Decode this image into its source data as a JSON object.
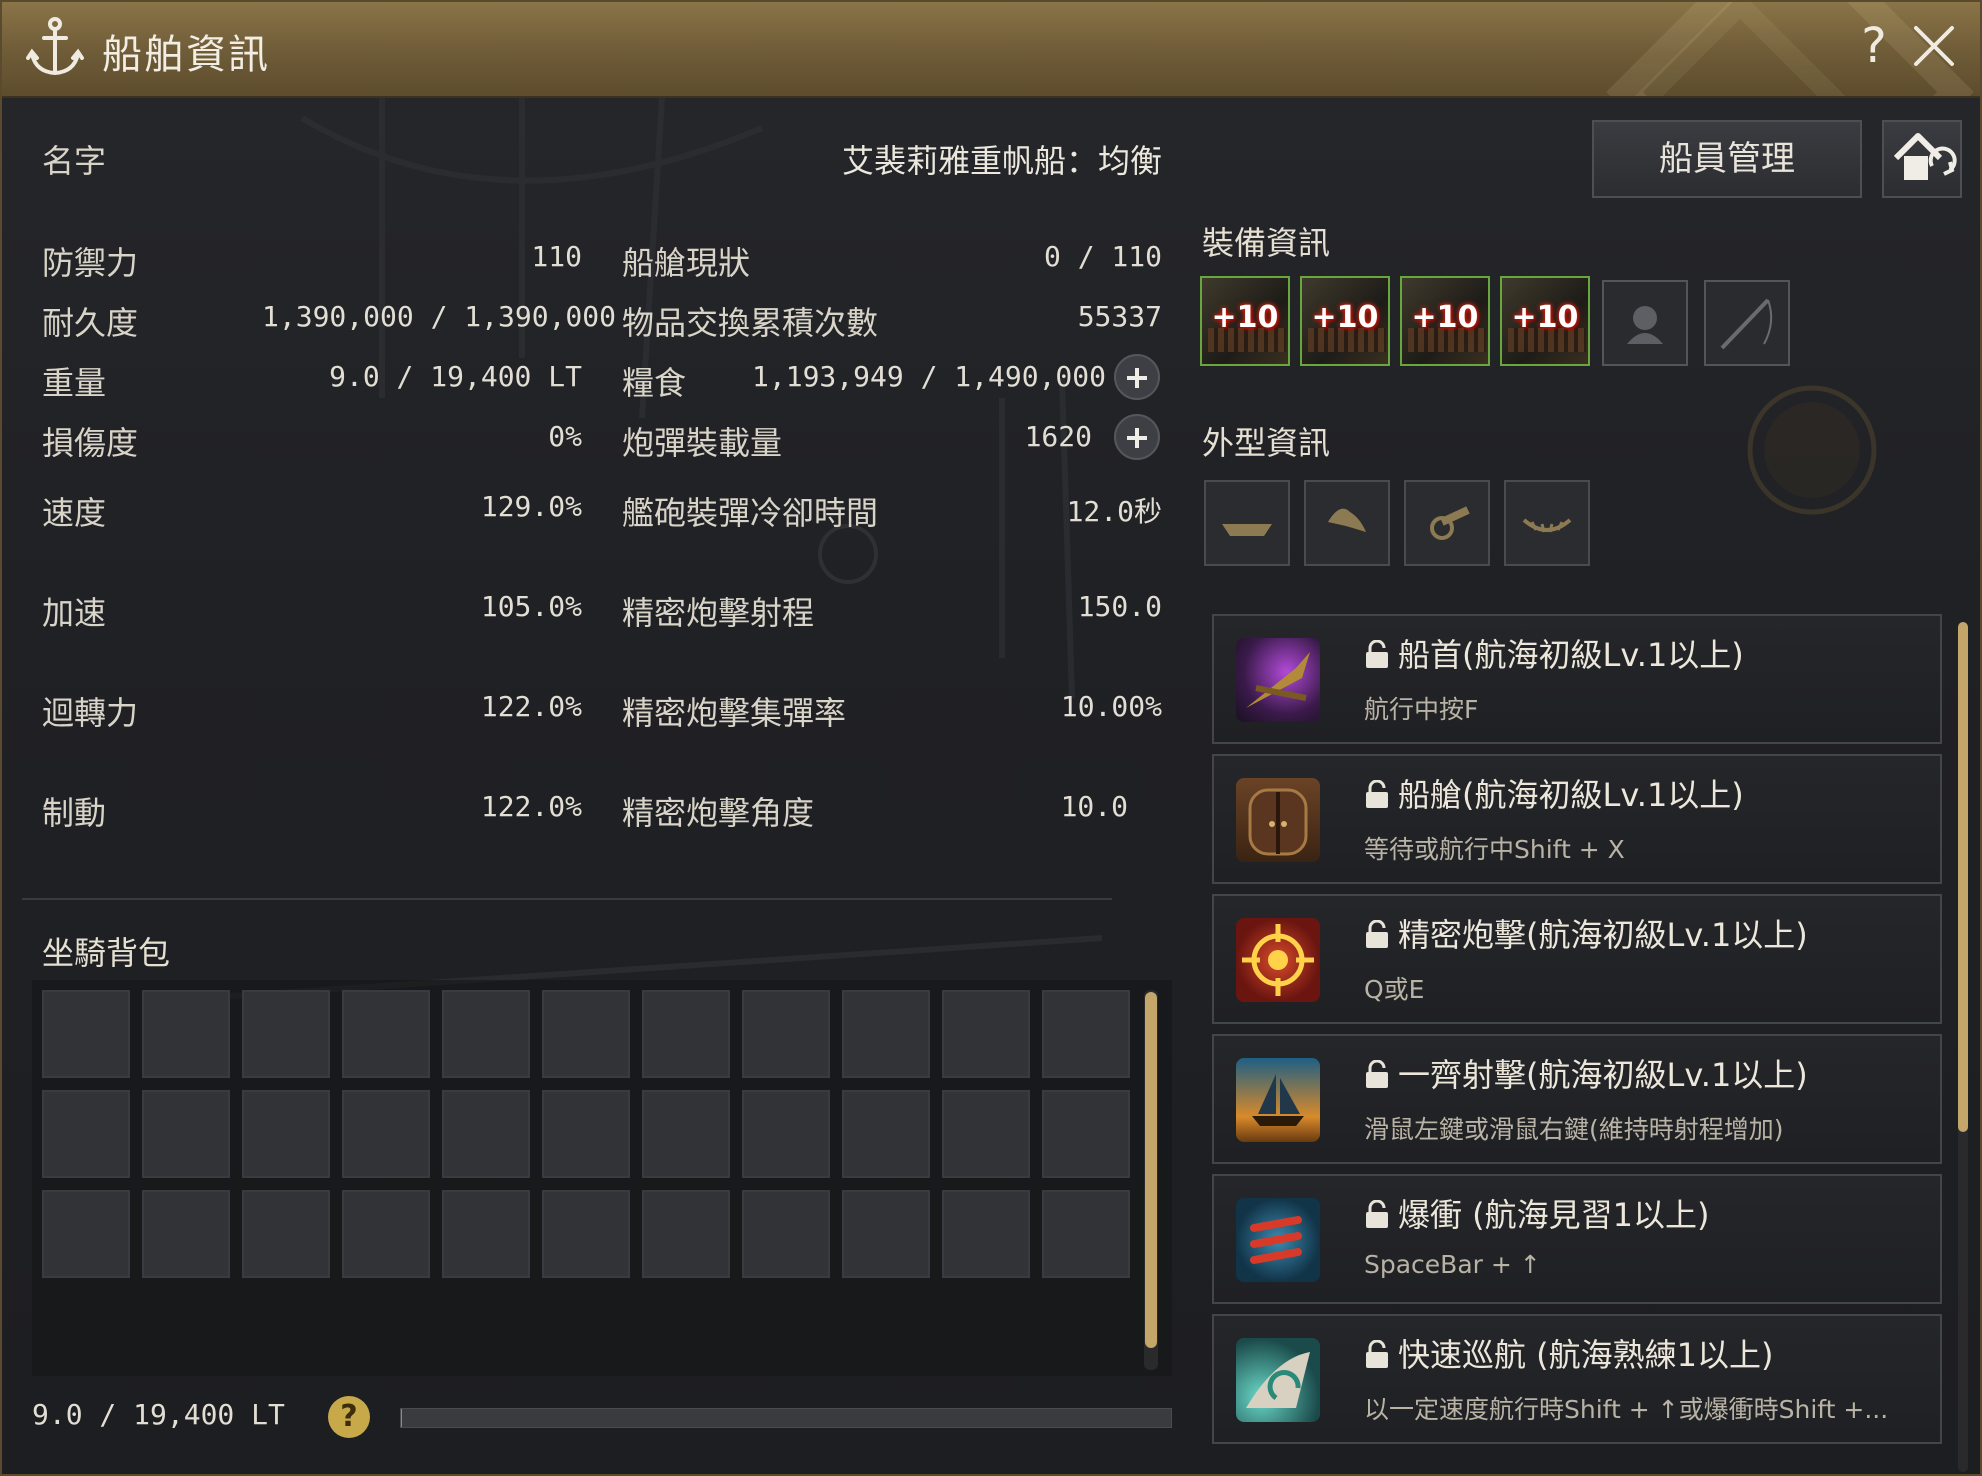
{
  "window": {
    "title": "船舶資訊",
    "help": "?"
  },
  "ship": {
    "name_label": "名字",
    "name": "艾裴莉雅重帆船：均衡"
  },
  "buttons": {
    "crew": "船員管理"
  },
  "stats_left": [
    {
      "label": "防禦力",
      "value": "110"
    },
    {
      "label": "耐久度",
      "value": "1,390,000 / 1,390,000"
    },
    {
      "label": "重量",
      "value": "9.0 / 19,400 LT"
    },
    {
      "label": "損傷度",
      "value": "0%"
    },
    {
      "label": "速度",
      "value": "129.0%"
    },
    {
      "label": "加速",
      "value": "105.0%"
    },
    {
      "label": "迴轉力",
      "value": "122.0%"
    },
    {
      "label": "制動",
      "value": "122.0%"
    }
  ],
  "stats_right": [
    {
      "label": "船艙現狀",
      "value": "0 / 110"
    },
    {
      "label": "物品交換累積次數",
      "value": "55337"
    },
    {
      "label": "糧食",
      "value": "1,193,949 / 1,490,000"
    },
    {
      "label": "炮彈裝載量",
      "value": "1620"
    },
    {
      "label": "艦砲裝彈冷卻時間",
      "value": "12.0秒"
    },
    {
      "label": "精密炮擊射程",
      "value": "150.0"
    },
    {
      "label": "精密炮擊集彈率",
      "value": "10.00%"
    },
    {
      "label": "精密炮擊角度",
      "value": "10.0"
    }
  ],
  "equipment": {
    "title": "裝備資訊",
    "slots": [
      {
        "label": "+10",
        "icon": "ship-prow-icon"
      },
      {
        "label": "+10",
        "icon": "ship-plating-icon"
      },
      {
        "label": "+10",
        "icon": "ship-cannon-icon"
      },
      {
        "label": "+10",
        "icon": "ship-sail-icon"
      },
      {
        "label": "",
        "icon": "sailor-icon"
      },
      {
        "label": "",
        "icon": "fishing-rod-icon"
      }
    ]
  },
  "appearance": {
    "title": "外型資訊",
    "slots": [
      {
        "icon": "hull-icon"
      },
      {
        "icon": "sail-shape-icon"
      },
      {
        "icon": "cannon-icon"
      },
      {
        "icon": "ornament-icon"
      }
    ]
  },
  "bag": {
    "title": "坐騎背包",
    "rows": 3,
    "cols": 11,
    "weight": "9.0 / 19,400 LT",
    "weight_fraction": 0.0005
  },
  "skills": [
    {
      "title": "船首(航海初級Lv.1以上)",
      "key": "航行中按F",
      "icon": "ram-icon"
    },
    {
      "title": "船艙(航海初級Lv.1以上)",
      "key": "等待或航行中Shift + X",
      "icon": "cabin-door-icon"
    },
    {
      "title": "精密炮擊(航海初級Lv.1以上)",
      "key": "Q或E",
      "icon": "crosshair-icon"
    },
    {
      "title": "一齊射擊(航海初級Lv.1以上)",
      "key": "滑鼠左鍵或滑鼠右鍵(維持時射程增加)",
      "icon": "ship-broadside-icon"
    },
    {
      "title": "爆衝 (航海見習1以上)",
      "key": "SpaceBar + ↑",
      "icon": "rockets-icon"
    },
    {
      "title": "快速巡航 (航海熟練1以上)",
      "key": "以一定速度航行時Shift + ↑或爆衝時Shift +...",
      "icon": "wind-sail-icon"
    }
  ],
  "colors": {
    "accent": "#c4a56a",
    "titlebar": "#7a6540",
    "equip_border": "#6aa63e"
  }
}
